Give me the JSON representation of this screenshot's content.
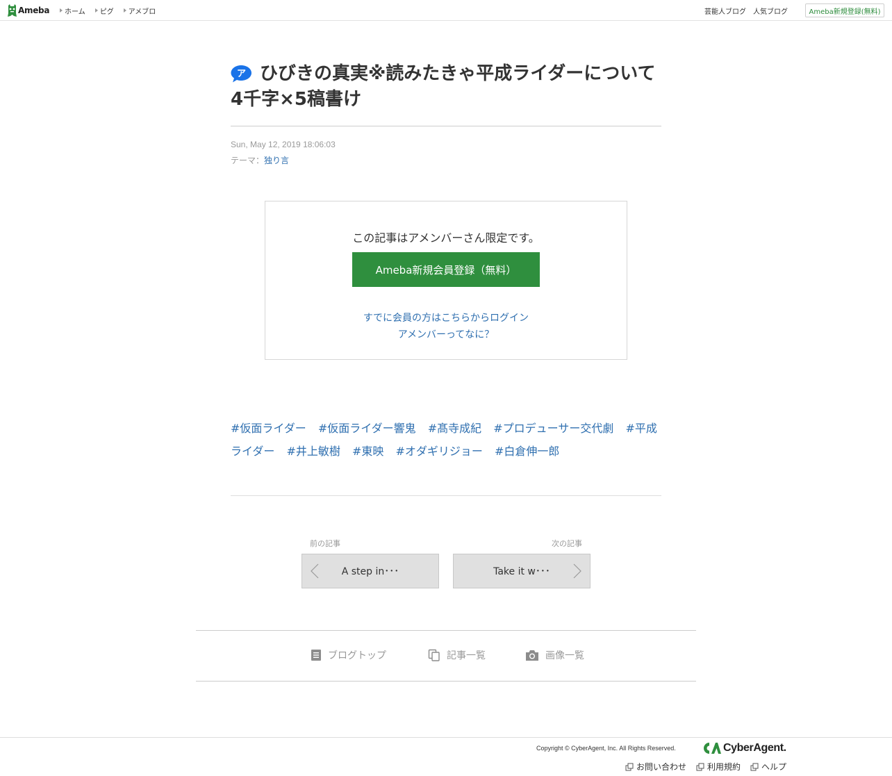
{
  "header": {
    "logo_text": "Ameba",
    "nav": [
      "ホーム",
      "ピグ",
      "アメブロ"
    ],
    "right_links": [
      "芸能人ブログ",
      "人気ブログ"
    ],
    "signup_label": "Ameba新規登録(無料)"
  },
  "article": {
    "title": "ひびきの真実※読みたきゃ平成ライダーについて4千字×5稿書け",
    "date": "Sun, May 12, 2019 18:06:03",
    "theme_label": "テーマ：",
    "theme_value": "独り言"
  },
  "member_box": {
    "message": "この記事はアメンバーさん限定です。",
    "register_button": "Ameba新規会員登録（無料）",
    "login_link": "すでに会員の方はこちらからログイン",
    "what_link": "アメンバーってなに？"
  },
  "hashtags": [
    "#仮面ライダー",
    "#仮面ライダー響鬼",
    "#髙寺成紀",
    "#プロデューサー交代劇",
    "#平成ライダー",
    "#井上敏樹",
    "#東映",
    "#オダギリジョー",
    "#白倉伸一郎"
  ],
  "pager": {
    "prev_label": "前の記事",
    "prev_title": "A step in･･･",
    "next_label": "次の記事",
    "next_title": "Take it w･･･"
  },
  "blog_nav": {
    "top": "ブログトップ",
    "list": "記事一覧",
    "images": "画像一覧"
  },
  "footer": {
    "copyright": "Copyright © CyberAgent, Inc. All Rights Reserved.",
    "company": "CyberAgent.",
    "links": [
      "お問い合わせ",
      "利用規約",
      "ヘルプ"
    ]
  },
  "colors": {
    "link": "#3070b0",
    "brand_green": "#2f8f3e",
    "muted": "#999999"
  }
}
